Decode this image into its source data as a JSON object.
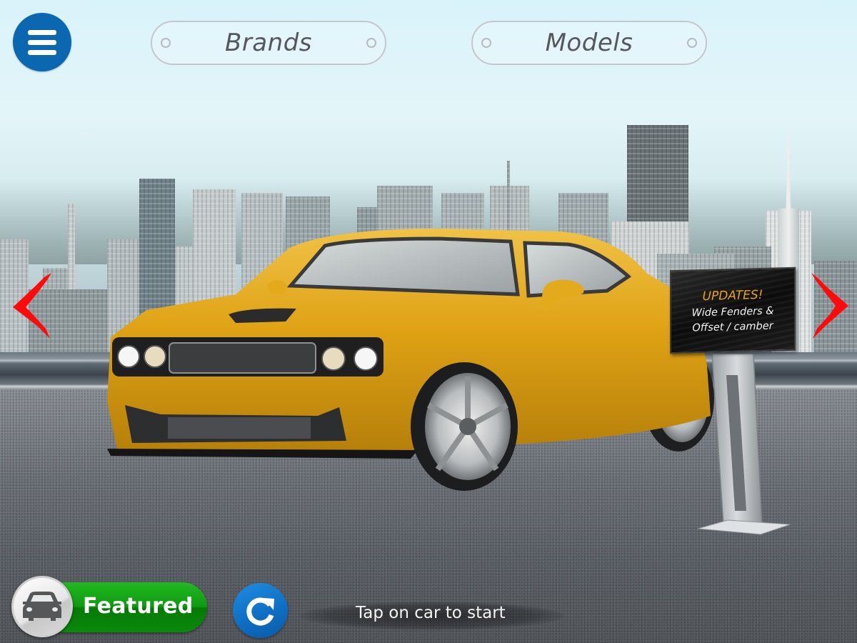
{
  "header": {
    "menu_icon": "hamburger-menu-icon",
    "brands_label": "Brands",
    "models_label": "Models"
  },
  "navigation": {
    "prev_icon": "chevron-left-icon",
    "next_icon": "chevron-right-icon"
  },
  "showcase": {
    "car_description": "Yellow widebody muscle car",
    "car_color": "#e0a415"
  },
  "updates_sign": {
    "heading": "UPDATES!",
    "lines": [
      "Wide Fenders &",
      "Offset / camber"
    ],
    "heading_color": "#e8a10f"
  },
  "footer": {
    "featured_label": "Featured",
    "featured_icon": "car-icon",
    "refresh_icon": "refresh-icon",
    "hint": "Tap on car to start"
  },
  "colors": {
    "menu_blue": "#0a67b0",
    "featured_green": "#0f9b10",
    "arrow_red": "#ff0000"
  }
}
